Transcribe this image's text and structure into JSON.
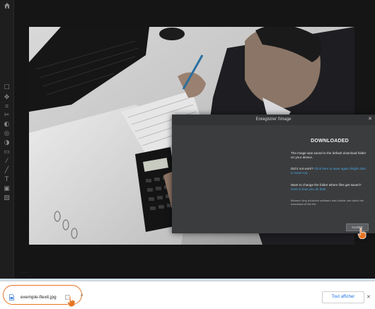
{
  "dialog": {
    "title": "Enregistrer l'image",
    "heading": "DOWNLOADED",
    "saved_text": "The image was saved to the default download folder on your device.",
    "didnt_work": "Did it not work?",
    "didnt_work_link": "Click here to save again (Right click to Save As).",
    "change_folder": "Want to change the folder where files get saved?",
    "change_folder_link": "Here is how you do that!",
    "note": "Beware! Any Ad-block software and similar can block the download of the file",
    "close_label": "CLOSE"
  },
  "download_bar": {
    "file_name": "exemple-flexit.jpg",
    "show_all_label": "Tout afficher"
  },
  "icons": {
    "home": "home-icon",
    "close": "close-icon",
    "chevron": "chevron-up-icon",
    "file": "image-file-icon"
  },
  "colors": {
    "highlight": "#e67524",
    "link": "#4aa8e0",
    "button_text": "#1a73e8"
  }
}
